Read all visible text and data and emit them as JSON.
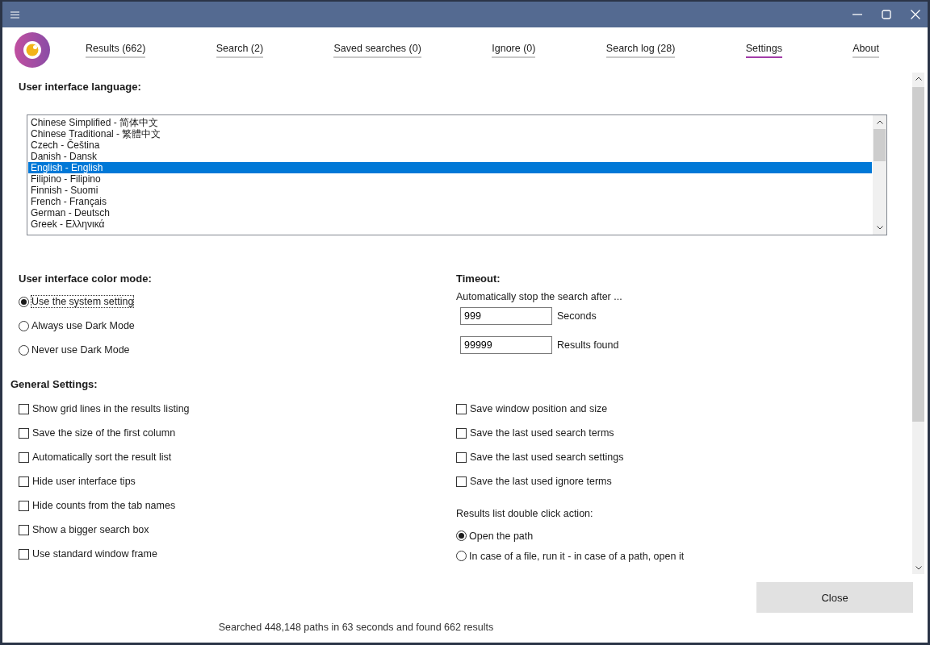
{
  "tabs": [
    {
      "label": "Results (662)",
      "selected": false
    },
    {
      "label": "Search (2)",
      "selected": false
    },
    {
      "label": "Saved searches (0)",
      "selected": false
    },
    {
      "label": "Ignore (0)",
      "selected": false
    },
    {
      "label": "Search log (28)",
      "selected": false
    },
    {
      "label": "Settings",
      "selected": true
    },
    {
      "label": "About",
      "selected": false
    }
  ],
  "language": {
    "heading": "User interface language:",
    "items": [
      {
        "label": "Chinese Simplified - 简体中文",
        "selected": false
      },
      {
        "label": "Chinese Traditional - 繁體中文",
        "selected": false
      },
      {
        "label": "Czech - Čeština",
        "selected": false
      },
      {
        "label": "Danish - Dansk",
        "selected": false
      },
      {
        "label": "English - English",
        "selected": true
      },
      {
        "label": "Filipino - Filipino",
        "selected": false
      },
      {
        "label": "Finnish - Suomi",
        "selected": false
      },
      {
        "label": "French - Français",
        "selected": false
      },
      {
        "label": "German - Deutsch",
        "selected": false
      },
      {
        "label": "Greek - Ελληνικά",
        "selected": false
      }
    ]
  },
  "color_mode": {
    "heading": "User interface color mode:",
    "options": [
      {
        "label": "Use the system setting",
        "selected": true
      },
      {
        "label": "Always use Dark Mode",
        "selected": false
      },
      {
        "label": "Never use Dark Mode",
        "selected": false
      }
    ]
  },
  "timeout": {
    "heading": "Timeout:",
    "description": "Automatically stop the search after ...",
    "fields": [
      {
        "value": "999",
        "unit": "Seconds"
      },
      {
        "value": "99999",
        "unit": "Results found"
      }
    ]
  },
  "general_settings": {
    "heading": "General Settings:",
    "left": [
      {
        "label": "Show grid lines in the results listing",
        "checked": false
      },
      {
        "label": "Save the size of the first column",
        "checked": false
      },
      {
        "label": "Automatically sort the result list",
        "checked": false
      },
      {
        "label": "Hide user interface tips",
        "checked": false
      },
      {
        "label": "Hide counts from the tab names",
        "checked": false
      },
      {
        "label": "Show a bigger search box",
        "checked": false
      },
      {
        "label": "Use standard window frame",
        "checked": false
      }
    ],
    "right": [
      {
        "label": "Save window position and size",
        "checked": false
      },
      {
        "label": "Save the last used search terms",
        "checked": false
      },
      {
        "label": "Save the last used search settings",
        "checked": false
      },
      {
        "label": "Save the last used ignore terms",
        "checked": false
      }
    ]
  },
  "double_click_action": {
    "label": "Results list double click action:",
    "options": [
      {
        "label": "Open the path",
        "selected": true
      },
      {
        "label": "In case of a file, run it - in case of a path, open it",
        "selected": false
      }
    ]
  },
  "close_button": "Close",
  "status": "Searched 448,148 paths in 63 seconds and found 662 results"
}
